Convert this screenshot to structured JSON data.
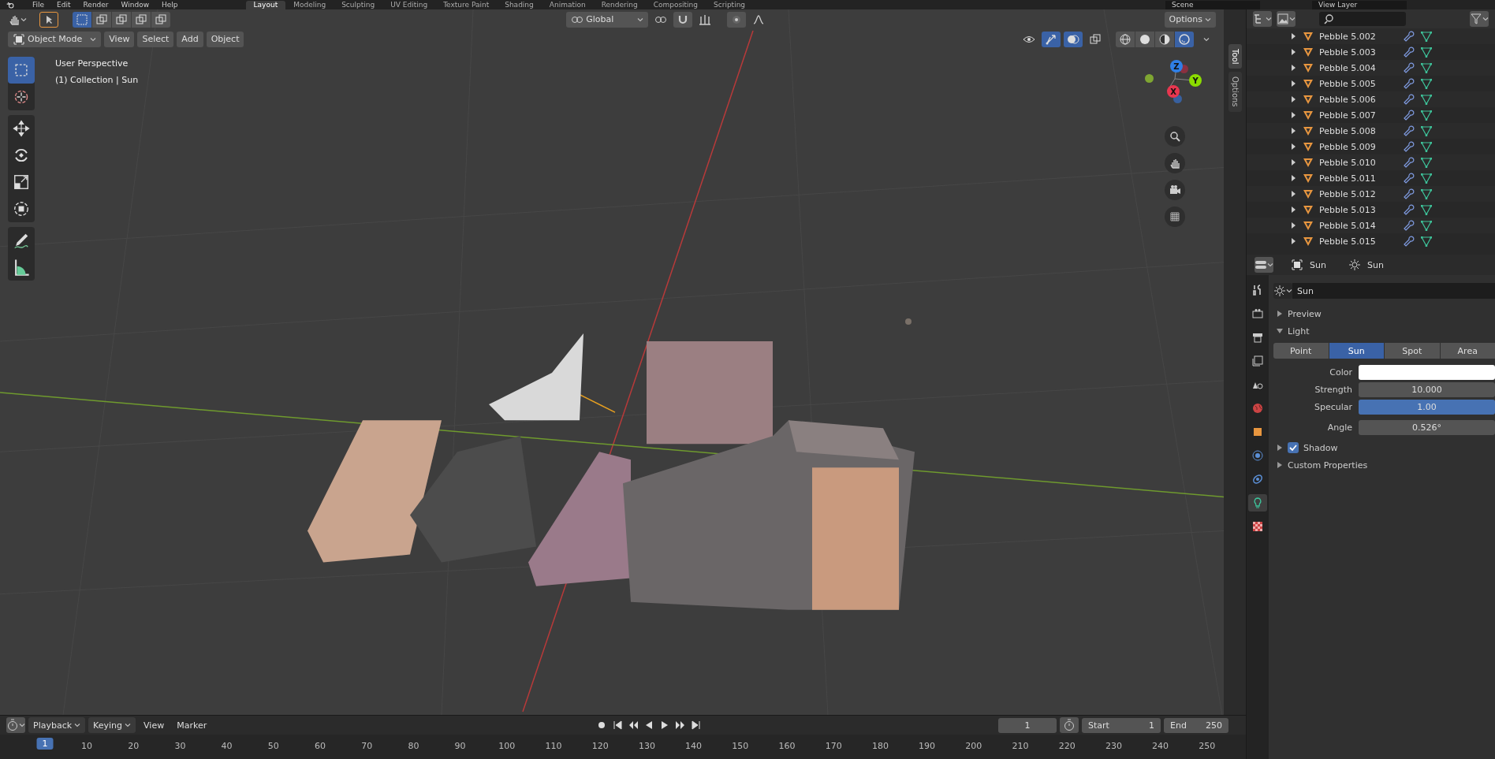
{
  "top_bar": {
    "menus": [
      "File",
      "Edit",
      "Render",
      "Window",
      "Help"
    ],
    "workspaces": [
      {
        "label": "Layout",
        "selected": true
      },
      {
        "label": "Modeling",
        "selected": false
      },
      {
        "label": "Sculpting",
        "selected": false
      },
      {
        "label": "UV Editing",
        "selected": false
      },
      {
        "label": "Texture Paint",
        "selected": false
      },
      {
        "label": "Shading",
        "selected": false
      },
      {
        "label": "Animation",
        "selected": false
      },
      {
        "label": "Rendering",
        "selected": false
      },
      {
        "label": "Compositing",
        "selected": false
      },
      {
        "label": "Scripting",
        "selected": false
      }
    ],
    "scene": "Scene",
    "view_layer": "View Layer"
  },
  "viewport": {
    "select_modes": [
      {
        "selected": true
      },
      {
        "selected": false
      },
      {
        "selected": false
      },
      {
        "selected": false
      },
      {
        "selected": false
      }
    ],
    "orientation": "Global",
    "options": "Options",
    "mode": "Object Mode",
    "menus": [
      "View",
      "Select",
      "Add",
      "Object"
    ],
    "toggles": [
      {
        "kind": "visibility",
        "on": false
      },
      {
        "kind": "gizmos",
        "on": true
      },
      {
        "kind": "overlays",
        "on": true
      },
      {
        "kind": "xray",
        "on": false
      }
    ],
    "shading": [
      {
        "kind": "wireframe",
        "selected": false
      },
      {
        "kind": "solid",
        "selected": false
      },
      {
        "kind": "material",
        "selected": false
      },
      {
        "kind": "rendered",
        "selected": true
      }
    ],
    "info": [
      "User Perspective",
      "(1) Collection | Sun"
    ],
    "tools": [
      {
        "kind": "select_box",
        "selected": true
      },
      {
        "kind": "cursor",
        "selected": false
      },
      {
        "kind": "move",
        "selected": false
      },
      {
        "kind": "rotate",
        "selected": false
      },
      {
        "kind": "scale",
        "selected": false
      },
      {
        "kind": "transform",
        "selected": false
      },
      {
        "kind": "annotate",
        "selected": false
      },
      {
        "kind": "measure",
        "selected": false
      }
    ],
    "gizmo": [
      {
        "label": "Z",
        "color": "#2f7fe6"
      },
      {
        "label": "X",
        "color": "#e8364f"
      },
      {
        "label": "Y",
        "color": "#8bdc00"
      }
    ],
    "sidebar_tabs": [
      {
        "label": "Tool",
        "selected": true
      },
      {
        "label": "Options",
        "selected": false
      }
    ]
  },
  "outliner": {
    "items": [
      {
        "name": "Pebble 5.002"
      },
      {
        "name": "Pebble 5.003"
      },
      {
        "name": "Pebble 5.004"
      },
      {
        "name": "Pebble 5.005"
      },
      {
        "name": "Pebble 5.006"
      },
      {
        "name": "Pebble 5.007"
      },
      {
        "name": "Pebble 5.008"
      },
      {
        "name": "Pebble 5.009"
      },
      {
        "name": "Pebble 5.010"
      },
      {
        "name": "Pebble 5.011"
      },
      {
        "name": "Pebble 5.012"
      },
      {
        "name": "Pebble 5.013"
      },
      {
        "name": "Pebble 5.014"
      },
      {
        "name": "Pebble 5.015"
      }
    ]
  },
  "properties": {
    "object": "Sun",
    "data": "Sun",
    "datablock": "Sun",
    "tabs": [
      {
        "kind": "tool",
        "selected": false
      },
      {
        "kind": "render",
        "selected": false
      },
      {
        "kind": "output",
        "selected": false
      },
      {
        "kind": "view_layer",
        "selected": false
      },
      {
        "kind": "scene",
        "selected": false
      },
      {
        "kind": "world",
        "selected": false
      },
      {
        "kind": "object",
        "selected": false
      },
      {
        "kind": "physics",
        "selected": false
      },
      {
        "kind": "constraints",
        "selected": false
      },
      {
        "kind": "light",
        "selected": true
      },
      {
        "kind": "texture",
        "selected": false
      }
    ],
    "preview": {
      "label": "Preview",
      "expanded": false
    },
    "light": {
      "label": "Light",
      "expanded": true,
      "types": [
        {
          "label": "Point",
          "selected": false
        },
        {
          "label": "Sun",
          "selected": true
        },
        {
          "label": "Spot",
          "selected": false
        },
        {
          "label": "Area",
          "selected": false
        }
      ],
      "fields": [
        {
          "kind": "color",
          "label": "Color",
          "color": "#ffffff"
        },
        {
          "kind": "number",
          "label": "Strength",
          "value": "10.000"
        },
        {
          "kind": "slider",
          "label": "Specular",
          "value": "1.00",
          "level": 1
        },
        {
          "kind": "number",
          "label": "Angle",
          "value": "0.526°"
        }
      ]
    },
    "shadow": {
      "label": "Shadow",
      "expanded": false,
      "checked": true
    },
    "custom": {
      "label": "Custom Properties",
      "expanded": false
    }
  },
  "timeline": {
    "menus": [
      "Playback",
      "Keying",
      "View",
      "Marker"
    ],
    "current_frame": "1",
    "start_label": "Start",
    "start": "1",
    "end_label": "End",
    "end": "250",
    "playhead": "1",
    "ruler": [
      "10",
      "20",
      "30",
      "40",
      "50",
      "60",
      "70",
      "80",
      "90",
      "100",
      "110",
      "120",
      "130",
      "140",
      "150",
      "160",
      "170",
      "180",
      "190",
      "200",
      "210",
      "220",
      "230",
      "240",
      "250"
    ]
  }
}
